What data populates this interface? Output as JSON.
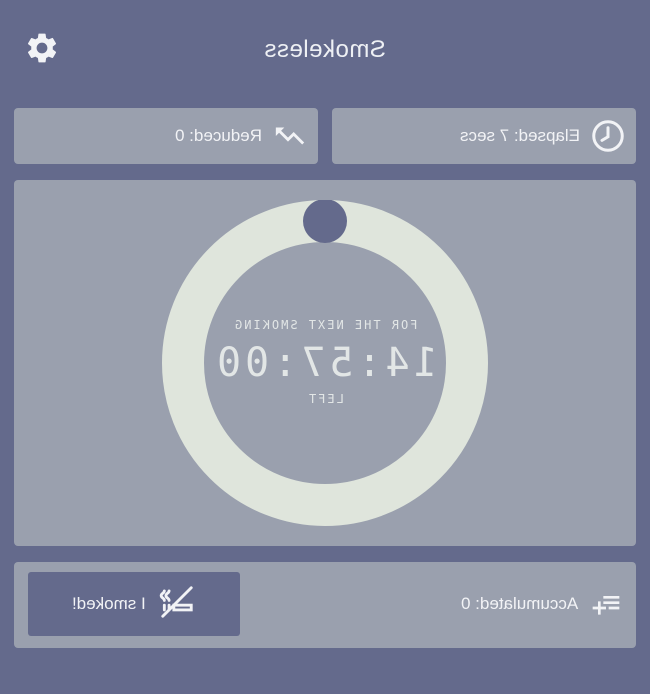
{
  "app": {
    "title": "Smokeless"
  },
  "stats": {
    "reduced": "Reduced: 0",
    "elapsed": "Elapsed: 7 secs"
  },
  "timer": {
    "caption_top": "FOR THE NEXT SMOKING",
    "time_left": "14:57:00",
    "caption_bottom": "LEFT",
    "progress": 0
  },
  "bottom": {
    "accumulated": "Accumulated: 0",
    "smoked_button": "I smoked!"
  },
  "icons": {
    "settings": "gear-icon",
    "reduced": "trending-up-icon",
    "elapsed": "clock-icon",
    "smoked": "smoking-icon",
    "accumulated": "playlist-add-icon"
  },
  "colors": {
    "background": "#646a8c",
    "card": "#9aa0ae",
    "ring": "#dfe5dc",
    "knob": "#646a8c",
    "text": "#f2f3f6"
  }
}
